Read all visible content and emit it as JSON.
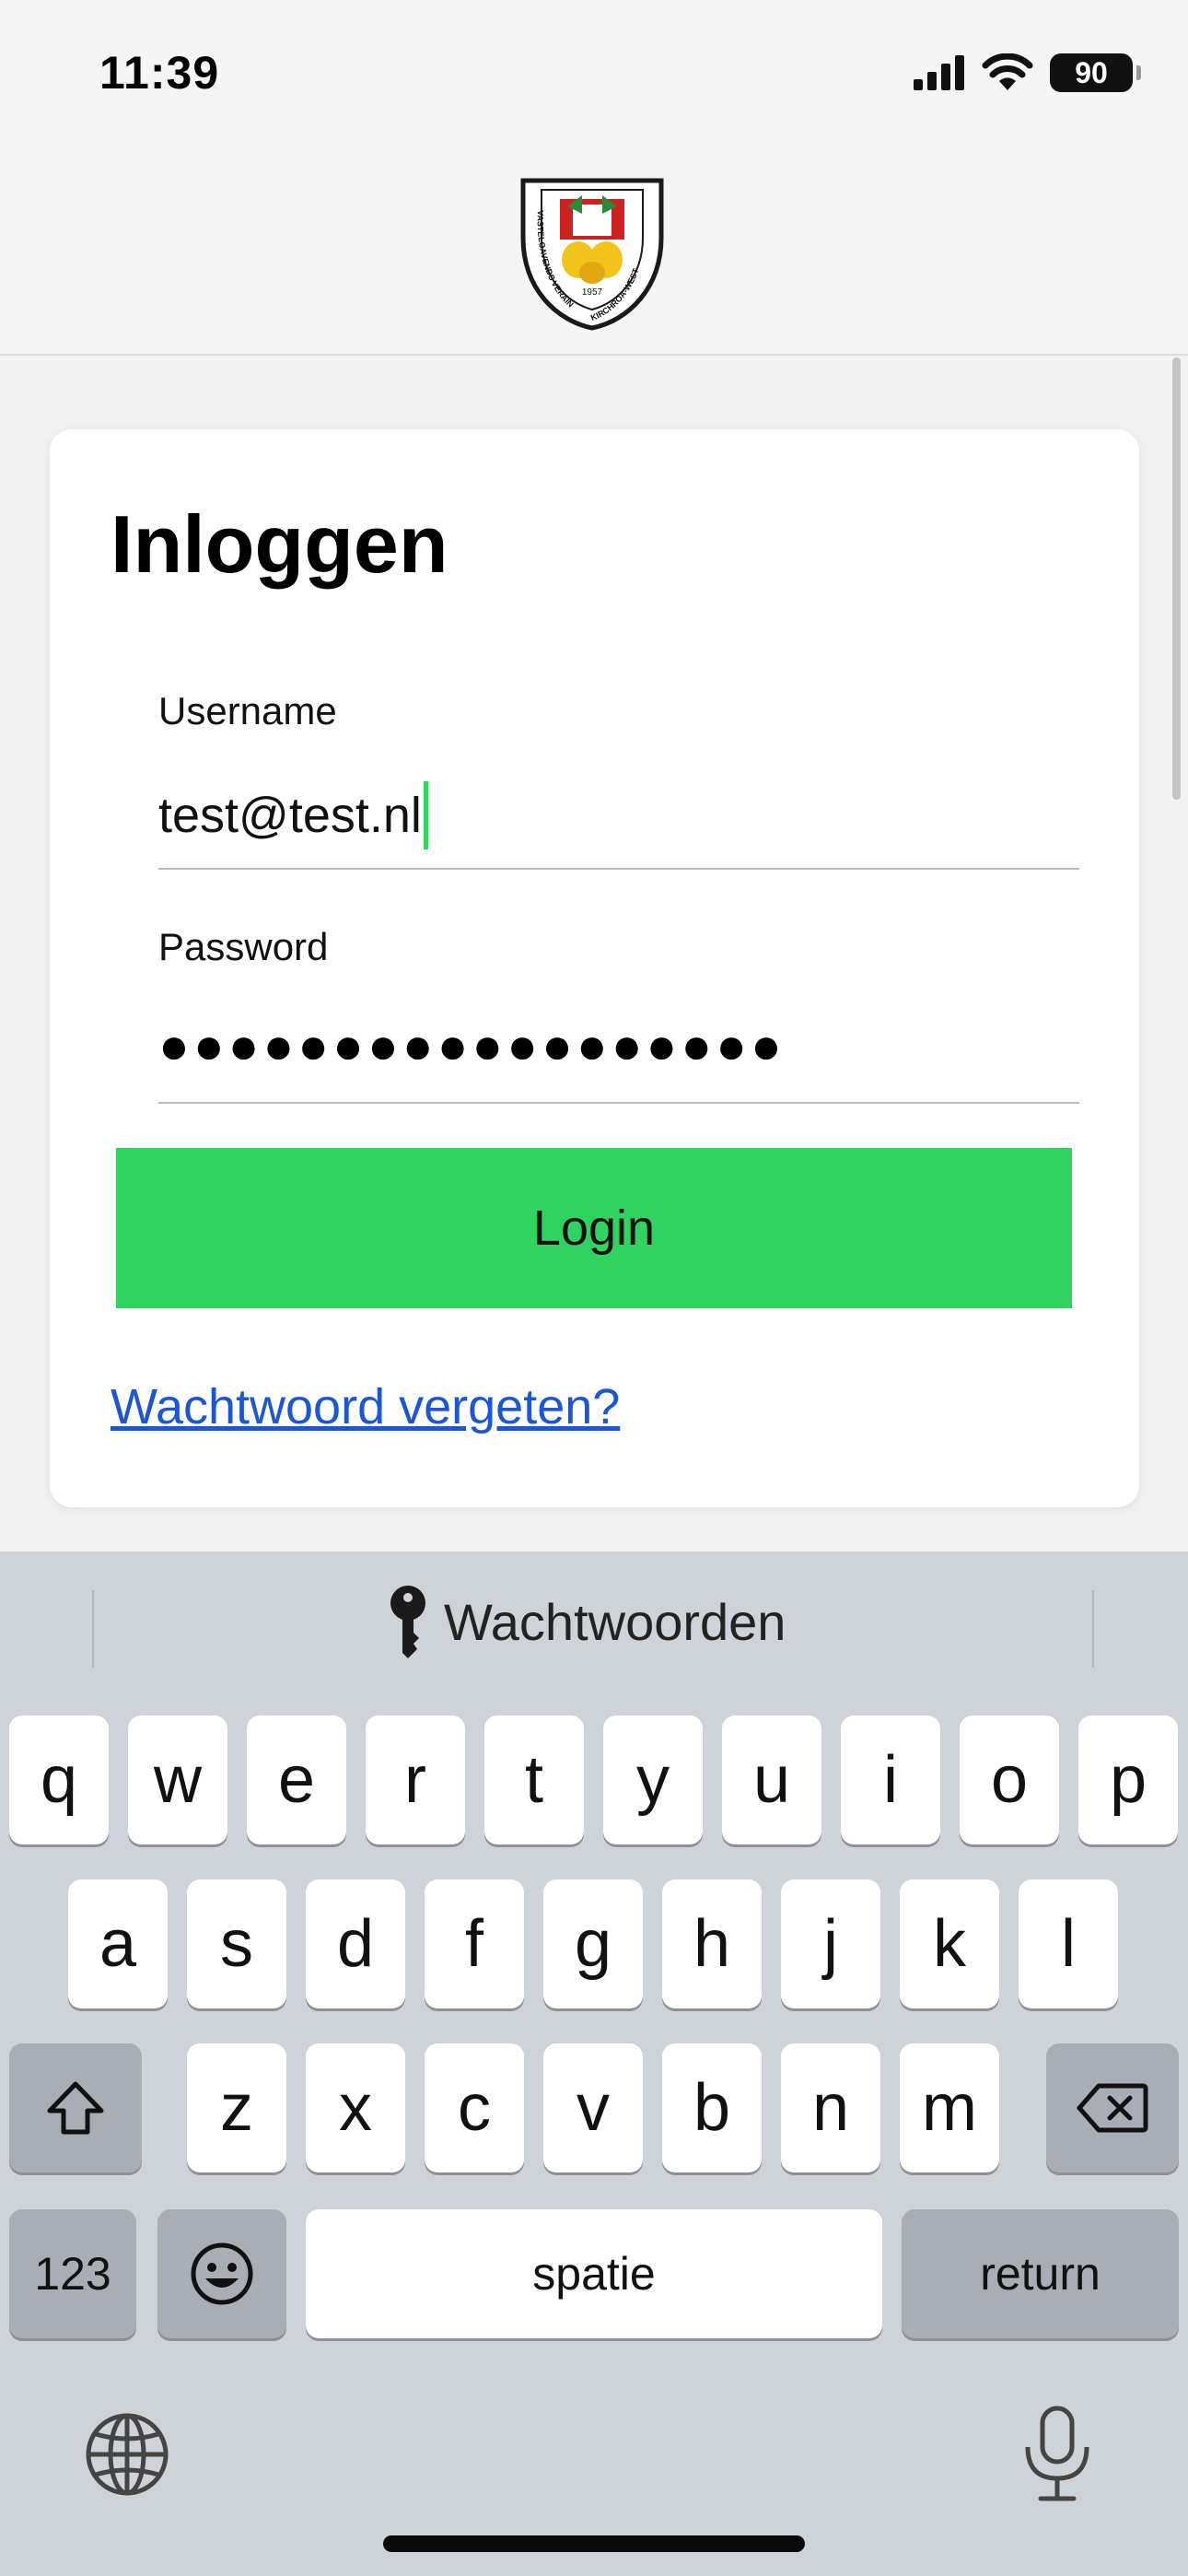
{
  "status_bar": {
    "time": "11:39",
    "battery": "90"
  },
  "header": {
    "logo_text": [
      "VASTELOAVENDS VERAIN KIRCHROA-WEST",
      "1957"
    ]
  },
  "card": {
    "title": "Inloggen",
    "username": {
      "label": "Username",
      "value": "test@test.nl"
    },
    "password": {
      "label": "Password",
      "value": "●●●●●●●●●●●●●●●●●●"
    },
    "login_label": "Login",
    "forgot_link": "Wachtwoord vergeten?"
  },
  "keyboard": {
    "suggestion": "Wachtwoorden",
    "row1": [
      "q",
      "w",
      "e",
      "r",
      "t",
      "y",
      "u",
      "i",
      "o",
      "p"
    ],
    "row2": [
      "a",
      "s",
      "d",
      "f",
      "g",
      "h",
      "j",
      "k",
      "l"
    ],
    "row3": [
      "z",
      "x",
      "c",
      "v",
      "b",
      "n",
      "m"
    ],
    "numbers_label": "123",
    "space_label": "spatie",
    "return_label": "return"
  },
  "colors": {
    "accent_green": "#31d360",
    "link_blue": "#1a56d6",
    "keyboard_bg": "#ced2d9"
  }
}
